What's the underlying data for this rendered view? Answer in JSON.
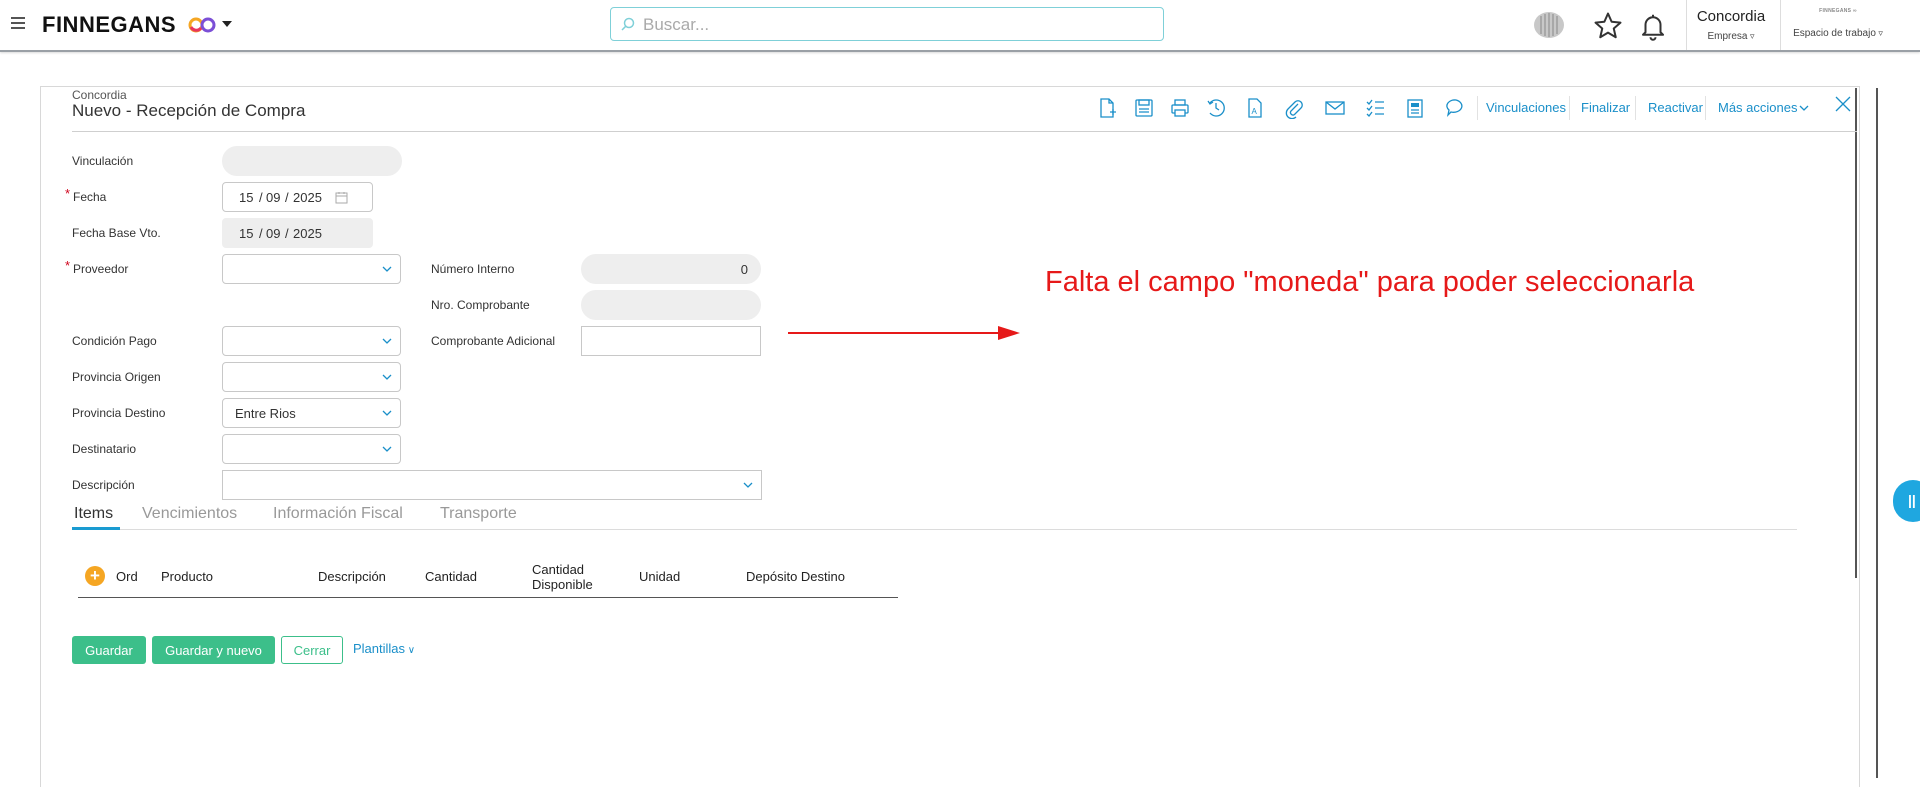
{
  "header": {
    "brand": "FINNEGANS",
    "search_placeholder": "Buscar...",
    "company": {
      "name": "Concordia",
      "label": "Empresa"
    },
    "workspace": {
      "logo_text": "FINNEGANS ∞",
      "label": "Espacio de trabajo"
    }
  },
  "page": {
    "breadcrumb": "Concordia",
    "title": "Nuevo - Recepción de Compra"
  },
  "toolbar": {
    "icons": [
      "new-document-icon",
      "save-icon",
      "print-icon",
      "history-icon",
      "text-document-icon",
      "attachment-icon",
      "email-icon",
      "checklist-icon",
      "report-icon",
      "comment-icon"
    ],
    "links": {
      "vinculaciones": "Vinculaciones",
      "finalizar": "Finalizar",
      "reactivar": "Reactivar",
      "mas_acciones": "Más acciones"
    }
  },
  "form": {
    "vinculacion": {
      "label": "Vinculación",
      "value": ""
    },
    "fecha": {
      "label": "Fecha",
      "day": "15",
      "month": "09",
      "year": "2025",
      "required": true
    },
    "fecha_base_vto": {
      "label": "Fecha Base Vto.",
      "day": "15",
      "month": "09",
      "year": "2025"
    },
    "proveedor": {
      "label": "Proveedor",
      "value": "",
      "required": true
    },
    "numero_interno": {
      "label": "Número Interno",
      "value": "0"
    },
    "nro_comprobante": {
      "label": "Nro. Comprobante",
      "value": ""
    },
    "condicion_pago": {
      "label": "Condición Pago",
      "value": ""
    },
    "comprobante_adicional": {
      "label": "Comprobante Adicional",
      "value": ""
    },
    "provincia_origen": {
      "label": "Provincia Origen",
      "value": ""
    },
    "provincia_destino": {
      "label": "Provincia Destino",
      "value": "Entre Rios"
    },
    "destinatario": {
      "label": "Destinatario",
      "value": ""
    },
    "descripcion": {
      "label": "Descripción",
      "value": ""
    }
  },
  "annotation": {
    "text": "Falta el campo \"moneda\" para poder seleccionarla",
    "color": "#e61919"
  },
  "tabs": [
    {
      "label": "Items",
      "active": true
    },
    {
      "label": "Vencimientos",
      "active": false
    },
    {
      "label": "Información Fiscal",
      "active": false
    },
    {
      "label": "Transporte",
      "active": false
    }
  ],
  "items_grid": {
    "add_symbol": "+",
    "columns": [
      "Ord",
      "Producto",
      "Descripción",
      "Cantidad",
      "Cantidad Disponible",
      "Unidad",
      "Depósito Destino"
    ],
    "rows": []
  },
  "actions": {
    "guardar": "Guardar",
    "guardar_y_nuevo": "Guardar y nuevo",
    "cerrar": "Cerrar",
    "plantillas": "Plantillas"
  },
  "colors": {
    "accent": "#1a8fc9",
    "primary_button": "#3cbf8a",
    "required": "#d0021b",
    "add_button": "#f5a623"
  }
}
